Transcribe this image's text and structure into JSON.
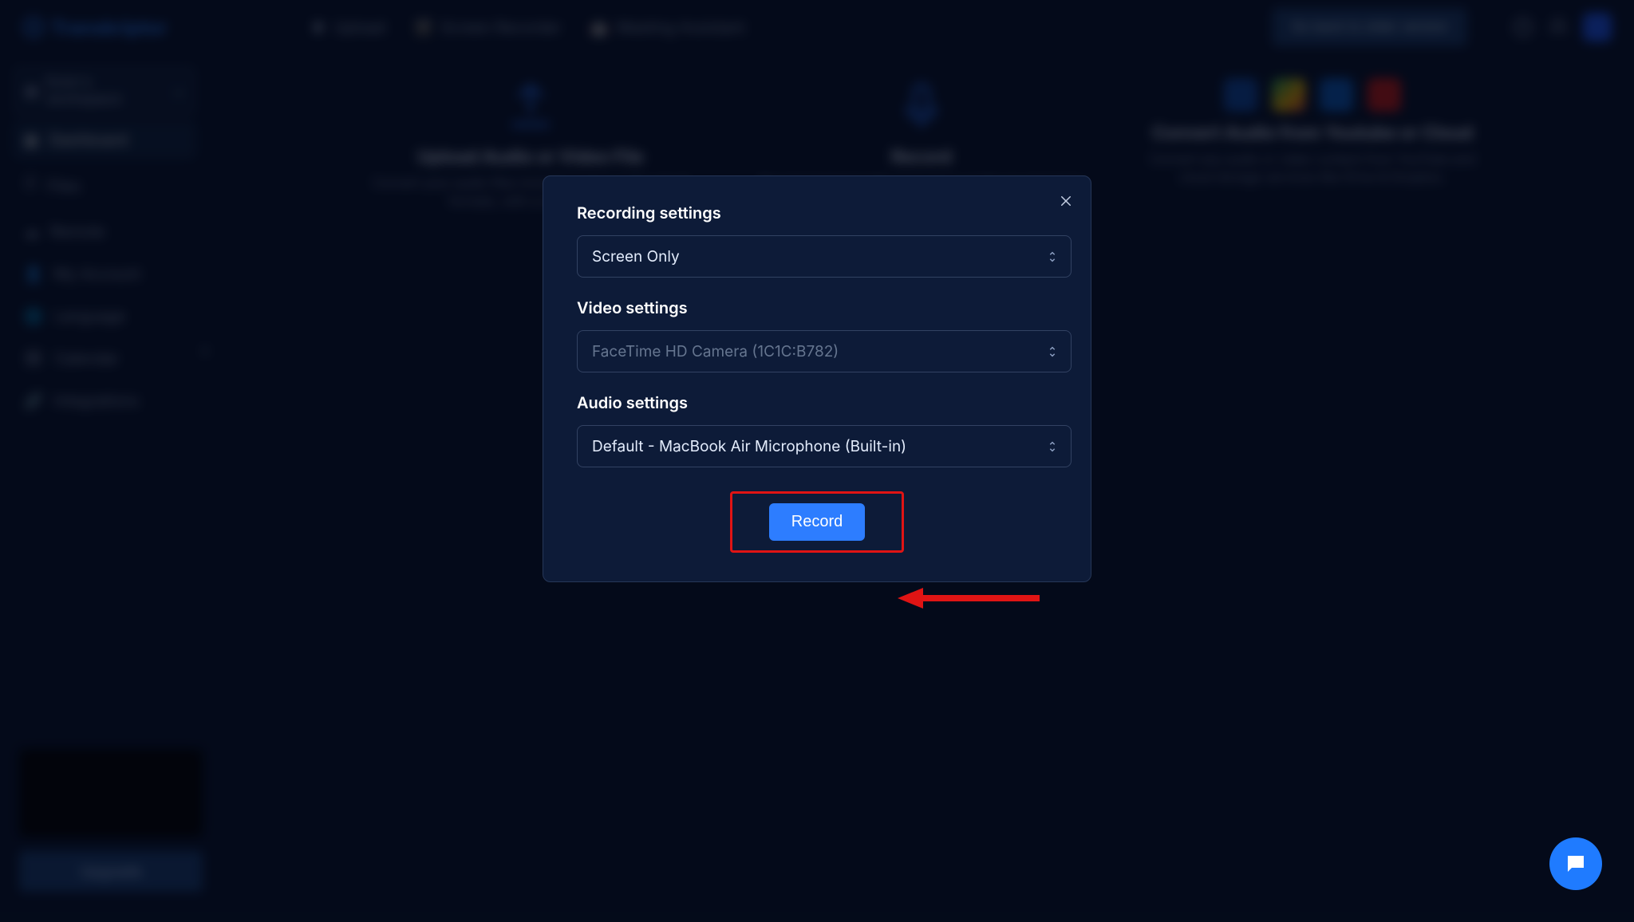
{
  "brand": "Transkriptor",
  "topnav": {
    "upload": "Upload",
    "recorder": "Screen Recorder",
    "meeting": "Meeting Assistant",
    "cta": "Go back to older version"
  },
  "sidebar": {
    "workspace": "Emin's workspace",
    "items": [
      {
        "label": "Dashboard"
      },
      {
        "label": "Files"
      },
      {
        "label": "Remote"
      },
      {
        "label": "My Account"
      },
      {
        "label": "Language"
      },
      {
        "label": "Calendar"
      },
      {
        "label": "Integrations"
      }
    ],
    "upgrade": "Upgrade"
  },
  "cards": {
    "upload": {
      "title": "Upload Audio or Video File",
      "desc": "Convert your audio files including many audio-visual formats, with a single click."
    },
    "record": {
      "title": "Record",
      "desc": "Record and transcribe your voice on the go and never miss a chance."
    },
    "cloud": {
      "title": "Convert Audio from Youtube or Cloud",
      "desc": "Convert any audio or video content from YouTube and cloud storage services like Drive & Dropbox."
    }
  },
  "modal": {
    "section_recording": "Recording settings",
    "recording_value": "Screen Only",
    "section_video": "Video settings",
    "video_value": "FaceTime HD Camera (1C1C:B782)",
    "section_audio": "Audio settings",
    "audio_value": "Default - MacBook Air Microphone (Built-in)",
    "record_button": "Record"
  }
}
